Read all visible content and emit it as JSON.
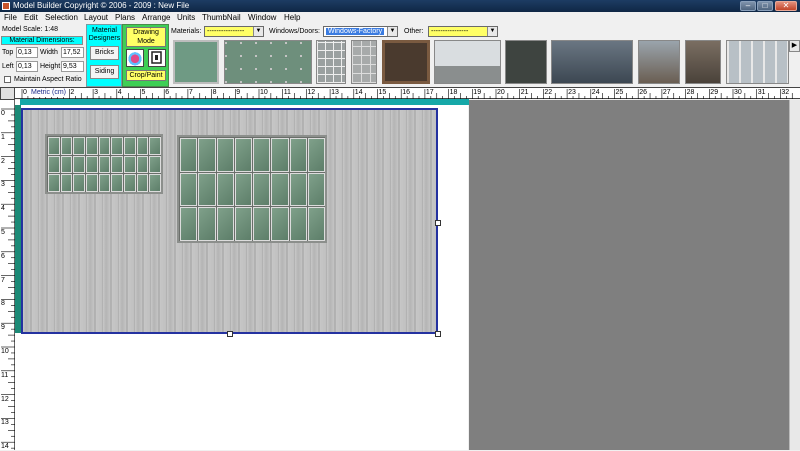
{
  "window": {
    "title": "Model Builder Copyright © 2006 - 2009 : New File",
    "minimize_glyph": "–",
    "maximize_glyph": "□",
    "close_glyph": "✕"
  },
  "menu": [
    "File",
    "Edit",
    "Selection",
    "Layout",
    "Plans",
    "Arrange",
    "Units",
    "ThumbNail",
    "Window",
    "Help"
  ],
  "model_scale": "Model Scale: 1:48",
  "dimensions": {
    "header": "Material  Dimensions:",
    "top_label": "Top",
    "top_value": "0,13",
    "width_label": "Width",
    "width_value": "17,52",
    "left_label": "Left",
    "left_value": "0,13",
    "height_label": "Height",
    "height_value": "9,53",
    "aspect_label": "Maintain Aspect Ratio"
  },
  "designers": {
    "title": "Material Designers",
    "bricks": "Bricks",
    "siding": "Siding"
  },
  "drawing": {
    "mode_label": "Drawing Mode",
    "crop_label": "Crop/Paint"
  },
  "dropdowns": {
    "materials_label": "Materials:",
    "materials_value": "----------------",
    "windows_label": "Windows/Doors:",
    "windows_value": "Windows-Factory",
    "other_label": "Other:",
    "other_value": "----------------"
  },
  "ruler": {
    "unit_label": "Metric (cm)",
    "h_ticks": [
      "0",
      "1",
      "2",
      "3",
      "4",
      "5",
      "6",
      "7",
      "8",
      "9",
      "10",
      "11",
      "12",
      "13",
      "14",
      "15",
      "16",
      "17",
      "18",
      "19",
      "20",
      "21",
      "22",
      "23",
      "24",
      "25",
      "26",
      "27",
      "28",
      "29",
      "30",
      "31",
      "32"
    ],
    "v_ticks": [
      "0",
      "1",
      "2",
      "3",
      "4",
      "5",
      "6",
      "7",
      "8",
      "9",
      "10",
      "11",
      "12",
      "13",
      "14"
    ]
  },
  "colors": {
    "designers_bg": "#00ffff",
    "drawing_bg": "#3ecf55",
    "selection_border": "#2532a0"
  },
  "icons": [
    "app-icon",
    "paint-tool-icon",
    "crop-tool-icon",
    "checkbox-icon",
    "dropdown-arrow-icon",
    "scroll-arrow-icon"
  ]
}
